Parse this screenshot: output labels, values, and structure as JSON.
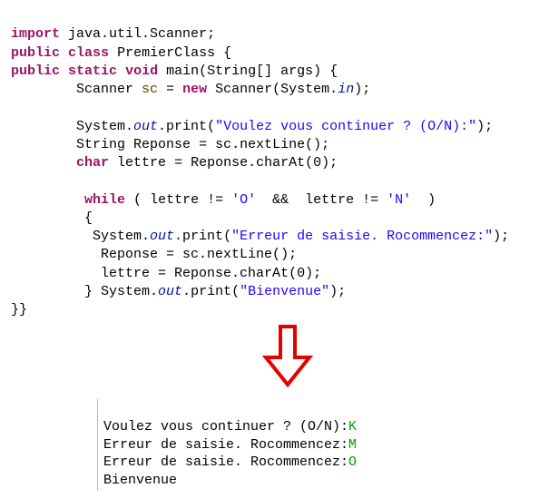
{
  "code": {
    "l1": {
      "kw_import": "import",
      "pkg": "java.util.Scanner",
      "semi": ";"
    },
    "l2": {
      "kw_public": "public",
      "kw_class": "class",
      "name": "PremierClass",
      "brace": "{"
    },
    "l3": {
      "kw_public": "public",
      "kw_static": "static",
      "kw_void": "void",
      "main": "main",
      "args_open": "(",
      "type": "String[]",
      "args": "args",
      "args_close": ")",
      "brace": "{"
    },
    "l4": {
      "indent": "        ",
      "type": "Scanner",
      "var": "sc",
      "eq": "=",
      "kw_new": "new",
      "ctor": "Scanner",
      "open": "(",
      "sys": "System.",
      "in": "in",
      "close": ");"
    },
    "l6": {
      "indent": "        ",
      "sys": "System.",
      "out": "out",
      "method": ".print",
      "open": "(",
      "str": "\"Voulez vous continuer ? (O/N):\"",
      "close": ");"
    },
    "l7": {
      "indent": "        ",
      "type": "String",
      "var": "Reponse",
      "eq": "=",
      "rhs": "sc.nextLine();"
    },
    "l8": {
      "indent": "        ",
      "kw_char": "char",
      "var": "lettre",
      "eq": "=",
      "rhs": "Reponse.charAt(",
      "num": "0",
      "rhs2": ");"
    },
    "l10": {
      "indent": "         ",
      "kw_while": "while",
      "open": "( ",
      "cond1": "lettre != ",
      "chr1": "'O'",
      "and": "  &&  ",
      "cond2": "lettre != ",
      "chr2": "'N'",
      "close": "  )"
    },
    "l11": {
      "indent": "         ",
      "brace": "{"
    },
    "l12": {
      "indent": "          ",
      "sys": "System.",
      "out": "out",
      "method": ".print",
      "open": "(",
      "str": "\"Erreur de saisie. Rocommencez:\"",
      "close": ");"
    },
    "l13": {
      "indent": "           ",
      "stmt": "Reponse = sc.nextLine();"
    },
    "l14": {
      "indent": "           ",
      "stmt": "lettre = Reponse.charAt(",
      "num": "0",
      "stmt2": ");"
    },
    "l15": {
      "indent": "         ",
      "brace": "} ",
      "sys": "System.",
      "out": "out",
      "method": ".print",
      "open": "(",
      "str": "\"Bienvenue\"",
      "close": ");"
    },
    "l16": {
      "text": "}}"
    }
  },
  "console": {
    "line1": {
      "prompt": "Voulez vous continuer ? (O/N):",
      "input": "K"
    },
    "line2": {
      "prompt": "Erreur de saisie. Rocommencez:",
      "input": "M"
    },
    "line3": {
      "prompt": "Erreur de saisie. Rocommencez:",
      "input": "O"
    },
    "line4": {
      "text": "Bienvenue"
    }
  }
}
